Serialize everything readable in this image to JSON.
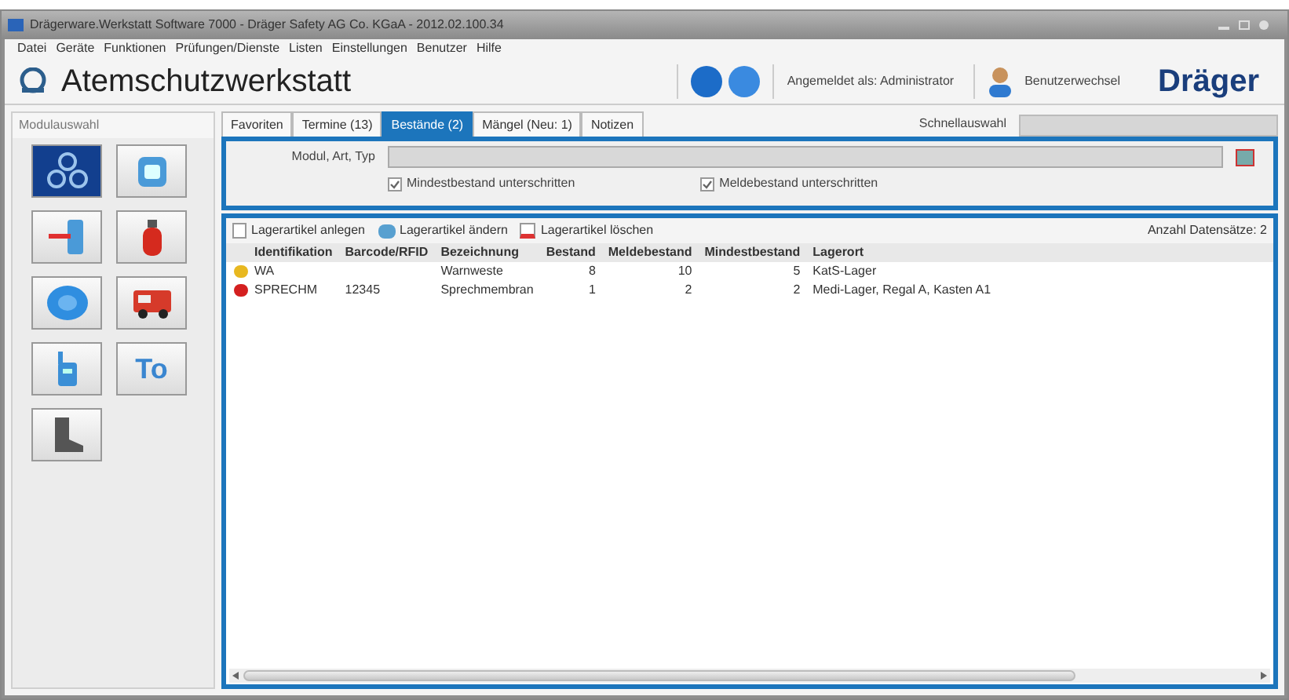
{
  "window": {
    "title": "Drägerware.Werkstatt Software 7000 - Dräger Safety AG  Co. KGaA - 2012.02.100.34"
  },
  "menu": [
    "Datei",
    "Geräte",
    "Funktionen",
    "Prüfungen/Dienste",
    "Listen",
    "Einstellungen",
    "Benutzer",
    "Hilfe"
  ],
  "header": {
    "title": "Atemschutzwerkstatt",
    "login": "Angemeldet als: Administrator",
    "switch_user": "Benutzerwechsel",
    "logo": "Dräger"
  },
  "sidebar": {
    "title": "Modulauswahl",
    "modules": [
      {
        "kind": "mask",
        "selected": true
      },
      {
        "kind": "bottle",
        "selected": false
      },
      {
        "kind": "cylinder",
        "selected": false
      },
      {
        "kind": "extinguisher",
        "selected": false
      },
      {
        "kind": "disc",
        "selected": false
      },
      {
        "kind": "truck",
        "selected": false
      },
      {
        "kind": "radio",
        "selected": false
      },
      {
        "kind": "text",
        "label": "To",
        "selected": false
      },
      {
        "kind": "boot",
        "selected": false
      }
    ]
  },
  "tabs": [
    {
      "label": "Favoriten",
      "selected": false
    },
    {
      "label": "Termine (13)",
      "selected": false
    },
    {
      "label": "Bestände (2)",
      "selected": true
    },
    {
      "label": "Mängel (Neu: 1)",
      "selected": false
    },
    {
      "label": "Notizen",
      "selected": false
    }
  ],
  "quick_select": {
    "label": "Schnellauswahl"
  },
  "filter": {
    "label": "Modul, Art, Typ",
    "checkboxes": [
      {
        "label": "Mindestbestand unterschritten",
        "checked": true
      },
      {
        "label": "Meldebestand unterschritten",
        "checked": true
      }
    ]
  },
  "toolbar": {
    "actions": [
      {
        "kind": "add",
        "label": "Lagerartikel anlegen"
      },
      {
        "kind": "edit",
        "label": "Lagerartikel ändern"
      },
      {
        "kind": "delete",
        "label": "Lagerartikel löschen"
      }
    ],
    "count": "Anzahl Datensätze: 2"
  },
  "table": {
    "columns": [
      "Identifikation",
      "Barcode/RFID",
      "Bezeichnung",
      "Bestand",
      "Meldebestand",
      "Mindestbestand",
      "Lagerort"
    ],
    "rows": [
      {
        "color": "#e8b820",
        "cells": [
          "WA",
          null,
          "Warnweste",
          "8",
          "10",
          "5",
          "KatS-Lager"
        ]
      },
      {
        "color": "#d42020",
        "cells": [
          "SPRECHM",
          "12345",
          "Sprechmembran",
          "1",
          "2",
          "2",
          "Medi-Lager, Regal A, Kasten A1"
        ]
      }
    ]
  }
}
